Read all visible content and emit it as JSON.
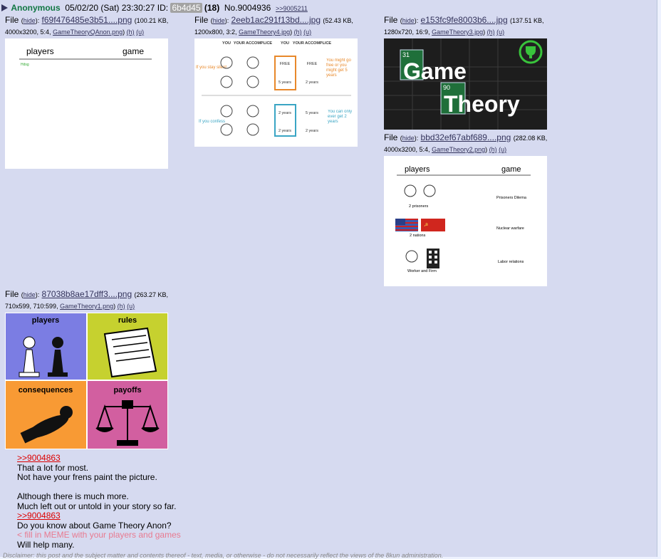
{
  "header": {
    "author": "Anonymous",
    "datetime": "05/02/20 (Sat) 23:30:27",
    "id_label": "ID:",
    "id_value": "6b4d45",
    "post_count": "(18)",
    "post_no": "No.9004936",
    "reply_link": ">>9005211"
  },
  "files": [
    {
      "label": "File",
      "hide": "hide",
      "name": "f69f476485e3b51....png",
      "info": "(100.21 KB, 4000x3200, 5:4,",
      "orig": "GameTheoryQAnon.png",
      "h": "(h)",
      "u": "(u)"
    },
    {
      "label": "File",
      "hide": "hide",
      "name": "2eeb1ac291f13bd....jpg",
      "info": "(52.43 KB, 1200x800, 3:2,",
      "orig": "GameTheory4.jpg",
      "h": "(h)",
      "u": "(u)"
    },
    {
      "label": "File",
      "hide": "hide",
      "name": "e153fc9fe8003b6....jpg",
      "info": "(137.51 KB, 1280x720, 16:9,",
      "orig": "GameTheory3.jpg",
      "h": "(h)",
      "u": "(u)"
    },
    {
      "label": "File",
      "hide": "hide",
      "name": "bbd32ef67abf689....png",
      "info": "(282.08 KB, 4000x3200, 5:4,",
      "orig": "GameTheory2.png",
      "h": "(h)",
      "u": "(u)"
    },
    {
      "label": "File",
      "hide": "hide",
      "name": "87038b8ae17dff3....png",
      "info": "(263.27 KB, 710x599, 710:599,",
      "orig": "GameTheory1.png",
      "h": "(h)",
      "u": "(u)"
    }
  ],
  "thumb1": {
    "players": "players",
    "game": "game",
    "note": "Hdsg"
  },
  "thumb2": {
    "col1": "YOU",
    "col2": "YOUR ACCOMPLICE",
    "col3": "YOU",
    "col4": "YOUR ACCOMPLICE",
    "silent": "If you stay silent",
    "confess": "If you confess",
    "free": "FREE",
    "five": "5 years",
    "two": "2 years",
    "note1": "You might go free or you might get 5 years",
    "note2": "You can only ever get 2 years"
  },
  "thumb3": {
    "num1": "31",
    "word1": "Game",
    "num2": "90",
    "word2": "Theory"
  },
  "thumb4": {
    "players": "players",
    "game": "game",
    "r1_who": "2 prisoners",
    "r1_game": "Prisoners Dilema",
    "r2_who": "2 nations",
    "r2_game": "Nuclear warfare",
    "r3_who": "Worker and Firm",
    "r3_game": "Labor relations"
  },
  "thumb5": {
    "q1": "players",
    "q2": "rules",
    "q3": "consequences",
    "q4": "payoffs"
  },
  "body": {
    "l1": ">>9004863",
    "l2": "That a lot for most.",
    "l3": "Not have your frens paint the picture.",
    "l4": "Although there is much more.",
    "l5": "Much left out or untold in your story so far.",
    "l6": ">>9004863",
    "l7": "Do you know about Game Theory Anon?",
    "l8": "< fill in MEME with your players and games",
    "l9": "Will help many."
  },
  "disclaimer": "Disclaimer: this post and the subject matter and contents thereof - text, media, or otherwise - do not necessarily reflect the views of the 8kun administration."
}
